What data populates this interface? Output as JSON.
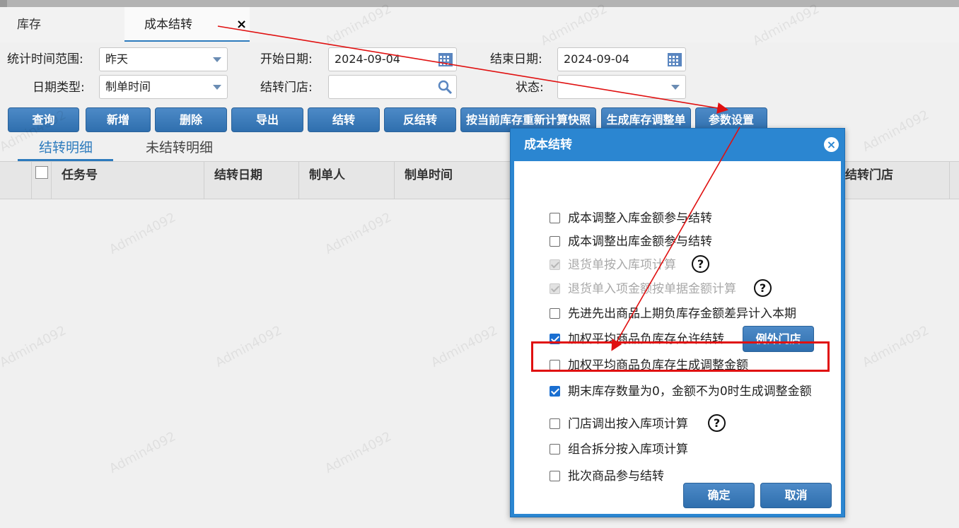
{
  "tabs": {
    "inventory": "库存",
    "cost_carryover": "成本结转",
    "close": "×"
  },
  "filters": {
    "range_label": "统计时间范围:",
    "range_value": "昨天",
    "start_label": "开始日期:",
    "start_value": "2024-09-04",
    "end_label": "结束日期:",
    "end_value": "2024-09-04",
    "date_type_label": "日期类型:",
    "date_type_value": "制单时间",
    "store_label": "结转门店:",
    "store_value": "",
    "status_label": "状态:",
    "status_value": ""
  },
  "toolbar": {
    "query": "查询",
    "add": "新增",
    "delete": "删除",
    "export": "导出",
    "carryover": "结转",
    "reverse": "反结转",
    "recalc": "按当前库存重新计算快照",
    "gen_adjust": "生成库存调整单",
    "params": "参数设置"
  },
  "subtabs": {
    "detail": "结转明细",
    "not_carried": "未结转明细"
  },
  "grid": {
    "columns": [
      "任务号",
      "结转日期",
      "制单人",
      "制单时间",
      "结转门店"
    ]
  },
  "watermark": "Admin4092",
  "dialog": {
    "title": "成本结转",
    "options": [
      {
        "label": "成本调整入库金额参与结转",
        "checked": false,
        "disabled": false
      },
      {
        "label": "成本调整出库金额参与结转",
        "checked": false,
        "disabled": false
      },
      {
        "label": "退货单按入库项计算",
        "checked": true,
        "disabled": true
      },
      {
        "label": "退货单入项金额按单据金额计算",
        "checked": true,
        "disabled": true
      },
      {
        "label": "先进先出商品上期负库存金额差异计入本期",
        "checked": false,
        "disabled": false
      },
      {
        "label": "加权平均商品负库存允许结转",
        "checked": true,
        "disabled": false
      },
      {
        "label": "加权平均商品负库存生成调整金额",
        "checked": false,
        "disabled": false
      },
      {
        "label": "期末库存数量为0，金额不为0时生成调整金额",
        "checked": true,
        "disabled": false
      },
      {
        "label": "门店调出按入库项计算",
        "checked": false,
        "disabled": false
      },
      {
        "label": "组合拆分按入库项计算",
        "checked": false,
        "disabled": false
      },
      {
        "label": "批次商品参与结转",
        "checked": false,
        "disabled": false
      }
    ],
    "help_symbol": "?",
    "exception_store_button": "例外门店",
    "ok": "确定",
    "cancel": "取消"
  },
  "colors": {
    "accent": "#2d7bbd",
    "button": "#3a7bbf",
    "highlight": "#e01010"
  }
}
